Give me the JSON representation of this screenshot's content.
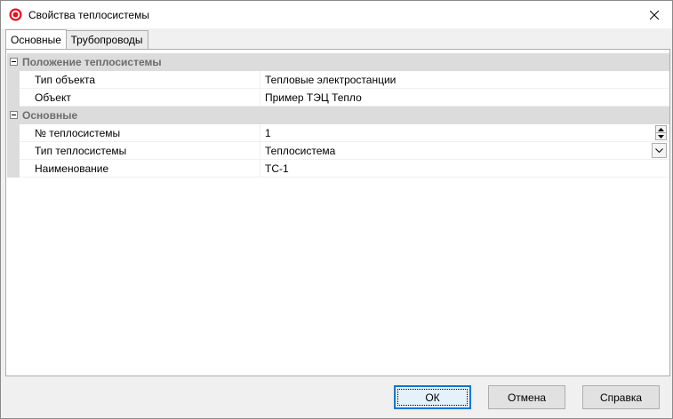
{
  "window": {
    "title": "Свойства теплосистемы"
  },
  "tabs": [
    {
      "label": "Основные",
      "active": true
    },
    {
      "label": "Трубопроводы",
      "active": false
    }
  ],
  "grid": {
    "categories": [
      {
        "label": "Положение теплосистемы",
        "rows": [
          {
            "name": "Тип объекта",
            "value": "Тепловые электростанции"
          },
          {
            "name": "Объект",
            "value": "Пример ТЭЦ Тепло"
          }
        ]
      },
      {
        "label": "Основные",
        "rows": [
          {
            "name": "№ теплосистемы",
            "value": "1"
          },
          {
            "name": "Тип теплосистемы",
            "value": "Теплосистема"
          },
          {
            "name": "Наименование",
            "value": "ТС-1"
          }
        ]
      }
    ]
  },
  "buttons": {
    "ok": "ОК",
    "cancel": "Отмена",
    "help": "Справка"
  },
  "colors": {
    "accent": "#0078d7",
    "app_icon": "#e81123"
  },
  "icons": {
    "app": "app-icon",
    "close": "close-icon",
    "spin_up": "chevron-up-icon",
    "spin_down": "chevron-down-icon",
    "dropdown": "chevron-down-icon"
  }
}
